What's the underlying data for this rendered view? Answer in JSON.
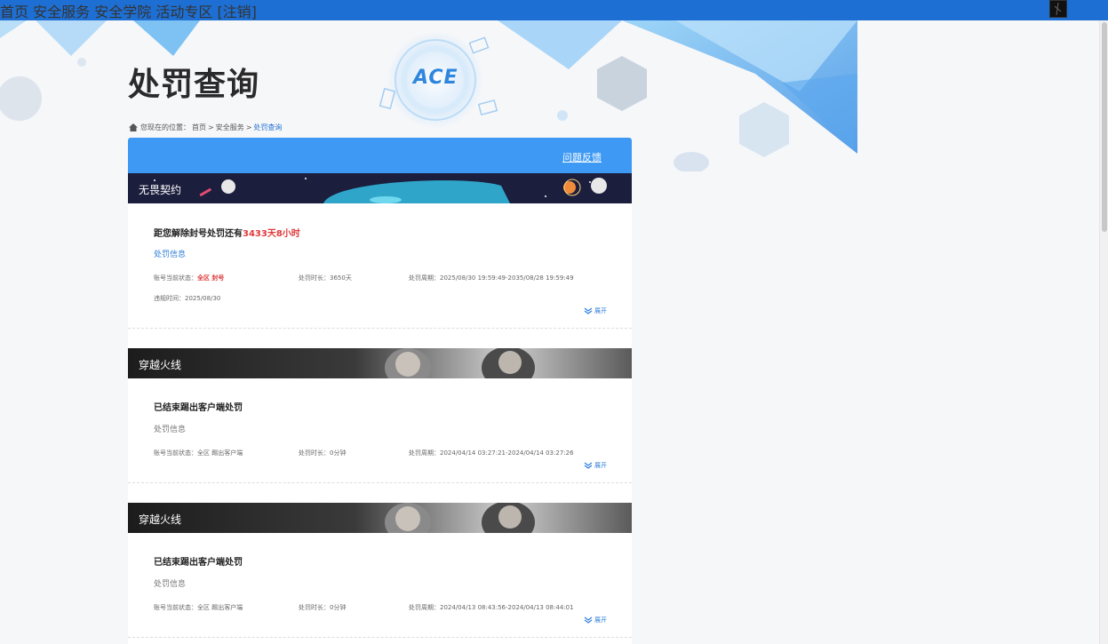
{
  "topnav": {
    "items": [
      "首页",
      "安全服务",
      "安全学院",
      "活动专区"
    ],
    "logout": "[注销]"
  },
  "page": {
    "title": "处罚查询",
    "breadcrumb": {
      "prefix": "您现在的位置：",
      "home": "首页",
      "sep": ">",
      "service": "安全服务",
      "current": "处罚查询"
    }
  },
  "panel": {
    "feedback": "问题反馈",
    "records": [
      {
        "game": "无畏契约",
        "title_prefix": "距您解除封号处罚还有",
        "title_remain": "3433天8小时",
        "info_label": "处罚信息",
        "status_label": "账号当前状态：",
        "status_value": "全区 封号",
        "duration_label": "处罚时长：",
        "duration_value": "3650天",
        "period_label": "处罚周期：",
        "period_value": "2025/08/30 19:59:49-2035/08/28 19:59:49",
        "violation_label": "违规时间：",
        "violation_value": "2025/08/30",
        "expand": "展开"
      },
      {
        "game": "穿越火线",
        "title": "已结束踢出客户端处罚",
        "info_label": "处罚信息",
        "status_label": "账号当前状态：",
        "status_value": "全区 踢出客户端",
        "duration_label": "处罚时长：",
        "duration_value": "0分钟",
        "period_label": "处罚周期：",
        "period_value": "2024/04/14 03:27:21-2024/04/14 03:27:26",
        "expand": "展开"
      },
      {
        "game": "穿越火线",
        "title": "已结束踢出客户端处罚",
        "info_label": "处罚信息",
        "status_label": "账号当前状态：",
        "status_value": "全区 踢出客户端",
        "duration_label": "处罚时长：",
        "duration_value": "0分钟",
        "period_label": "处罚周期：",
        "period_value": "2024/04/13 08:43:56-2024/04/13 08:44:01",
        "expand": "展开"
      }
    ]
  },
  "logo_text": "ACE",
  "colors": {
    "topbar": "#1e6fd3",
    "panel_head": "#3d99f3",
    "accent_red": "#e0393b",
    "link_blue": "#2f7fd8"
  }
}
